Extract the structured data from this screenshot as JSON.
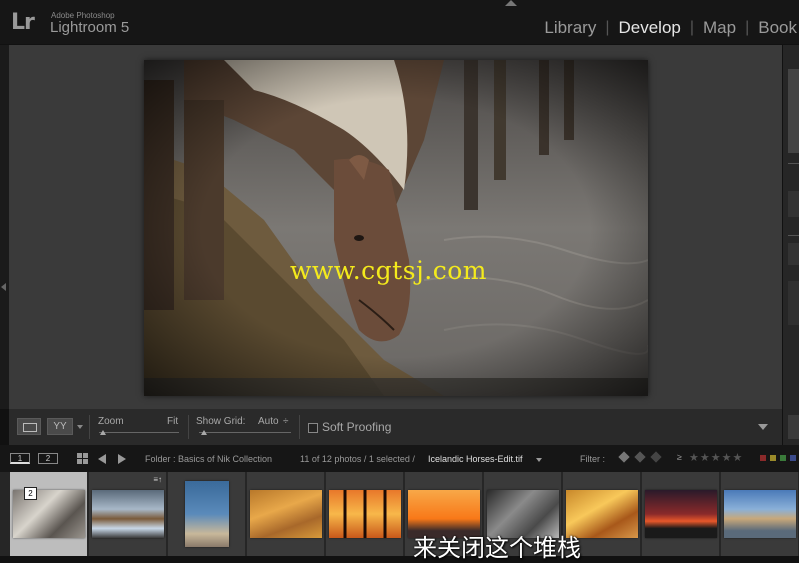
{
  "app": {
    "logo": "Lr",
    "subtitle": "Adobe Photoshop",
    "name": "Lightroom 5"
  },
  "modules": [
    {
      "label": "Library",
      "active": false
    },
    {
      "label": "Develop",
      "active": true
    },
    {
      "label": "Map",
      "active": false
    },
    {
      "label": "Book",
      "active": false
    }
  ],
  "photo": {
    "watermark": "www.cgtsj.com"
  },
  "toolbar": {
    "yy_label": "YY",
    "zoom_label": "Zoom",
    "zoom_value": "Fit",
    "grid_label": "Show Grid:",
    "grid_value": "Auto",
    "grid_stepper": "÷",
    "soft_proofing": "Soft Proofing"
  },
  "filmstrip_bar": {
    "monitor_1": "1",
    "monitor_2": "2",
    "folder": "Folder : Basics of Nik Collection",
    "count": "11 of 12 photos / 1 selected /",
    "filename": "Icelandic Horses-Edit.tif",
    "filter_label": "Filter :",
    "rating_op": "≥",
    "stars": "★★★★★"
  },
  "filmstrip": {
    "stack_count": "2",
    "stack_indicator": "≡↑",
    "thumbs": [
      {
        "name": "thumb-horses-bw",
        "selected": true
      },
      {
        "name": "thumb-waterfall",
        "selected": false
      },
      {
        "name": "thumb-pelican",
        "selected": false
      },
      {
        "name": "thumb-sand-dunes",
        "selected": false
      },
      {
        "name": "thumb-pier-sunset",
        "selected": false
      },
      {
        "name": "thumb-orange-sunset",
        "selected": false
      },
      {
        "name": "thumb-rocks",
        "selected": false
      },
      {
        "name": "thumb-canyon",
        "selected": false
      },
      {
        "name": "thumb-red-sky",
        "selected": false
      },
      {
        "name": "thumb-venice",
        "selected": false
      }
    ]
  },
  "subtitle": "来关闭这个堆栈",
  "colors": {
    "watermark": "#f4ea1c",
    "active_module": "#e6e6e6",
    "inactive_module": "#9a9a9a"
  }
}
